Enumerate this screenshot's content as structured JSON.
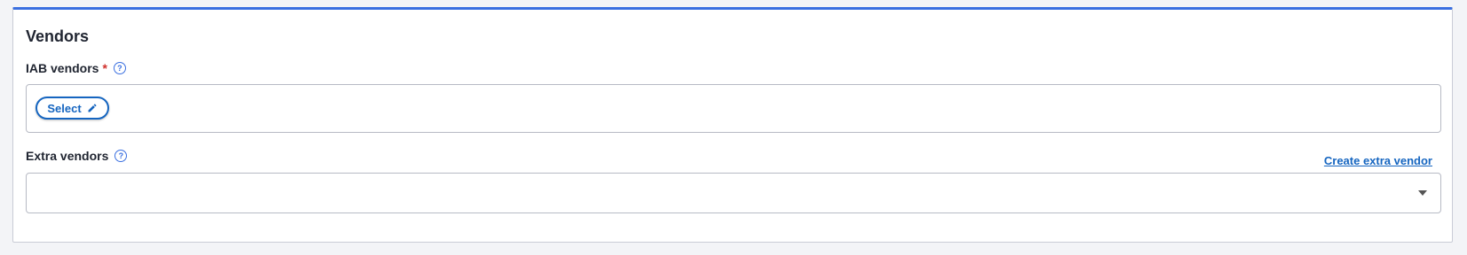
{
  "section": {
    "title": "Vendors"
  },
  "iab_vendors": {
    "label": "IAB vendors",
    "required_mark": "*",
    "help_icon": "question-circle-icon",
    "select_button_label": "Select",
    "select_button_icon": "pencil-icon"
  },
  "extra_vendors": {
    "label": "Extra vendors",
    "help_icon": "question-circle-icon",
    "create_link_label": "Create extra vendor",
    "dropdown_value": "",
    "dropdown_icon": "caret-down-icon"
  },
  "colors": {
    "accent": "#3a6fe0",
    "link": "#1565c0",
    "required": "#d0312d"
  }
}
